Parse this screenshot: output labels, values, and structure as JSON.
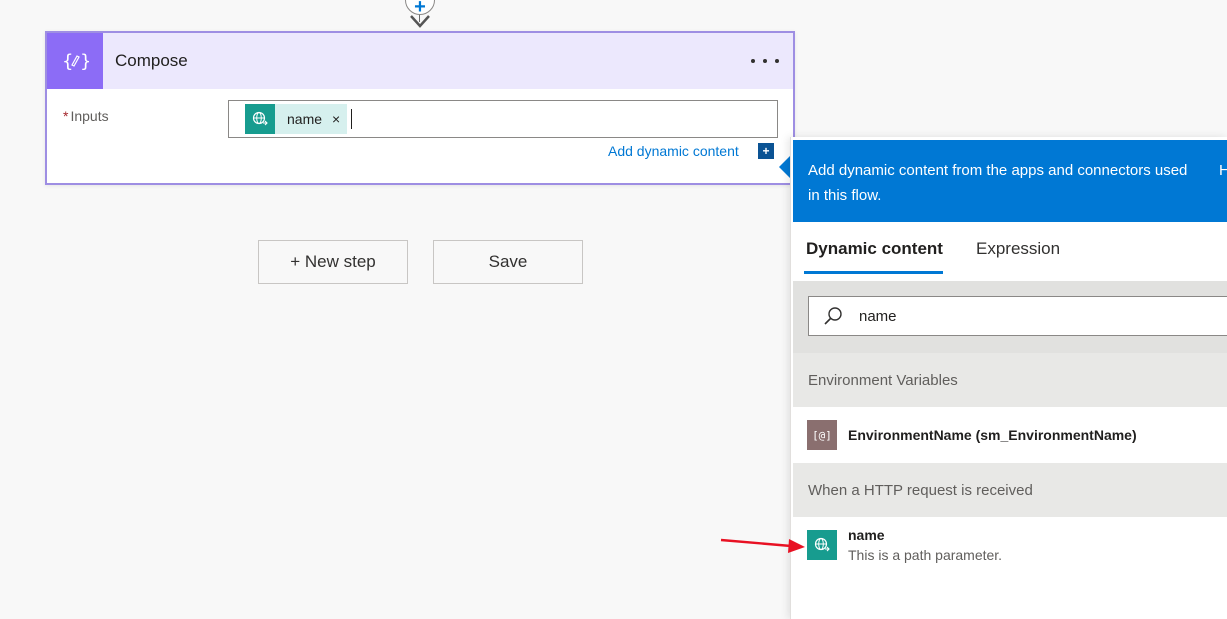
{
  "compose_card": {
    "title": "Compose",
    "inputs_label": "Inputs",
    "required_marker": "*",
    "token": {
      "label": "name",
      "close": "×"
    },
    "add_dynamic_label": "Add dynamic content",
    "add_dynamic_button": "+"
  },
  "steps": {
    "new_step_label": "+ New step",
    "save_label": "Save"
  },
  "dynamic_panel": {
    "header_text": "Add dynamic content from the apps and connectors used in this flow.",
    "header_truncated": "H",
    "tabs": [
      {
        "label": "Dynamic content",
        "active": true
      },
      {
        "label": "Expression",
        "active": false
      }
    ],
    "search": {
      "value": "name"
    },
    "sections": [
      {
        "title": "Environment Variables",
        "items": [
          {
            "icon": "environment-variable-icon",
            "icon_text": "[@]",
            "title": "EnvironmentName (sm_EnvironmentName)",
            "description": ""
          }
        ]
      },
      {
        "title": "When a HTTP request is received",
        "items": [
          {
            "icon": "http-request-icon",
            "title": "name",
            "description": "This is a path parameter."
          }
        ]
      }
    ]
  },
  "colors": {
    "compose_accent": "#8c6cf6",
    "compose_header_bg": "#ece8fd",
    "http_connector": "#179c8f",
    "panel_header": "#0078d4",
    "annotation_arrow": "#e81123"
  }
}
